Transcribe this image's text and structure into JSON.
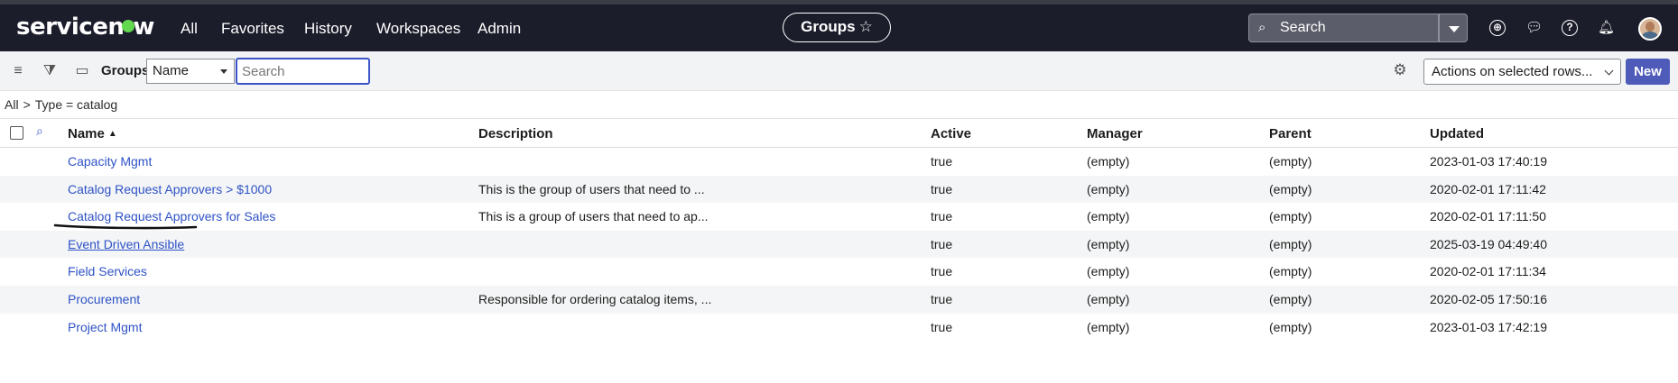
{
  "header": {
    "logo_text": "servicenow",
    "nav": [
      "All",
      "Favorites",
      "History",
      "Workspaces",
      "Admin"
    ],
    "center_title": "Groups",
    "search_placeholder": "Search"
  },
  "toolbar": {
    "list_title": "Groups",
    "field_select": "Name",
    "search_placeholder": "Search",
    "actions_label": "Actions on selected rows...",
    "new_label": "New"
  },
  "breadcrumb": {
    "all": "All",
    "separator": ">",
    "filter": "Type = catalog"
  },
  "table": {
    "columns": [
      "Name",
      "Description",
      "Active",
      "Manager",
      "Parent",
      "Updated"
    ],
    "rows": [
      [
        "Capacity Mgmt",
        "",
        "true",
        "(empty)",
        "(empty)",
        "2023-01-03 17:40:19"
      ],
      [
        "Catalog Request Approvers > $1000",
        "This is the group of users that need to ...",
        "true",
        "(empty)",
        "(empty)",
        "2020-02-01 17:11:42"
      ],
      [
        "Catalog Request Approvers for Sales",
        "This is a group of users that need to ap...",
        "true",
        "(empty)",
        "(empty)",
        "2020-02-01 17:11:50"
      ],
      [
        "Event Driven Ansible",
        "",
        "true",
        "(empty)",
        "(empty)",
        "2025-03-19 04:49:40"
      ],
      [
        "Field Services",
        "",
        "true",
        "(empty)",
        "(empty)",
        "2020-02-01 17:11:34"
      ],
      [
        "Procurement",
        "Responsible for ordering catalog items, ...",
        "true",
        "(empty)",
        "(empty)",
        "2020-02-05 17:50:16"
      ],
      [
        "Project Mgmt",
        "",
        "true",
        "(empty)",
        "(empty)",
        "2023-01-03 17:42:19"
      ]
    ]
  },
  "colors": {
    "topbar": "#1c1d2b",
    "link": "#2e52c6",
    "primary_button": "#4f5bb9",
    "focus_border": "#3a54c9"
  }
}
